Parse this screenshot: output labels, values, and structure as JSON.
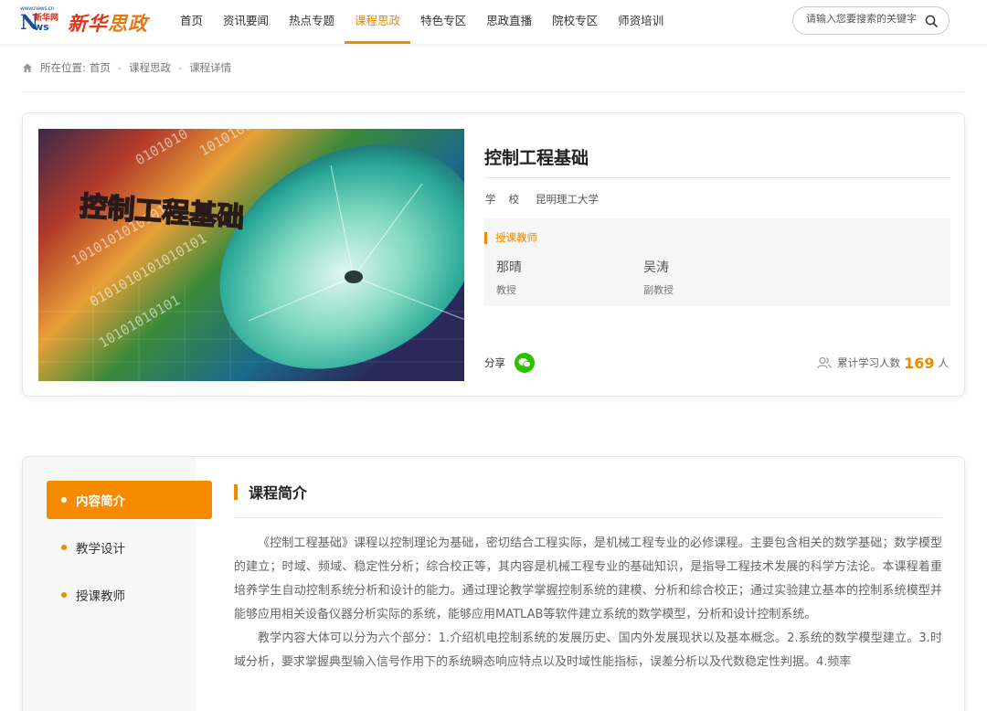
{
  "header": {
    "logo": {
      "news_url": "www.news.cn",
      "news_mark": "N",
      "news_suffix": "ws",
      "xinhua": "新华网",
      "title_a": "新华",
      "title_b": "思政"
    },
    "nav": [
      {
        "label": "首页",
        "active": false
      },
      {
        "label": "资讯要闻",
        "active": false
      },
      {
        "label": "热点专题",
        "active": false
      },
      {
        "label": "课程思政",
        "active": true
      },
      {
        "label": "特色专区",
        "active": false
      },
      {
        "label": "思政直播",
        "active": false
      },
      {
        "label": "院校专区",
        "active": false
      },
      {
        "label": "师资培训",
        "active": false
      }
    ],
    "search": {
      "placeholder": "请输入您要搜索的关键字"
    }
  },
  "breadcrumb": {
    "prefix": "所在位置:",
    "items": [
      "首页",
      "课程思政",
      "课程详情"
    ],
    "separator": "-"
  },
  "course": {
    "title": "控制工程基础",
    "school_label": "学校",
    "school": "昆明理工大学",
    "cover_text": "控制工程基础",
    "teachers_heading": "授课教师",
    "teachers": [
      {
        "name": "那晴",
        "rank": "教授"
      },
      {
        "name": "吴涛",
        "rank": "副教授"
      }
    ],
    "share_label": "分享",
    "learners_label": "累计学习人数",
    "learners_count": "169",
    "learners_unit": "人"
  },
  "content": {
    "tabs": [
      {
        "label": "内容简介",
        "active": true
      },
      {
        "label": "教学设计",
        "active": false
      },
      {
        "label": "授课教师",
        "active": false
      }
    ],
    "section_title": "课程简介",
    "paragraphs": [
      "《控制工程基础》课程以控制理论为基础，密切结合工程实际，是机械工程专业的必修课程。主要包含相关的数学基础；数学模型的建立；时域、频域、稳定性分析；综合校正等，其内容是机械工程专业的基础知识，是指导工程技术发展的科学方法论。本课程着重培养学生自动控制系统分析和设计的能力。通过理论教学掌握控制系统的建模、分析和综合校正；通过实验建立基本的控制系统模型并能够应用相关设备仪器分析实际的系统，能够应用MATLAB等软件建立系统的数学模型，分析和设计控制系统。",
      "教学内容大体可以分为六个部分：1.介绍机电控制系统的发展历史、国内外发展现状以及基本概念。2.系统的数学模型建立。3.时域分析，要求掌握典型输入信号作用下的系统瞬态响应特点以及时域性能指标，误差分析以及代数稳定性判据。4.频率"
    ]
  },
  "colors": {
    "accent": "#f08a00",
    "wechat": "#2dc100"
  }
}
